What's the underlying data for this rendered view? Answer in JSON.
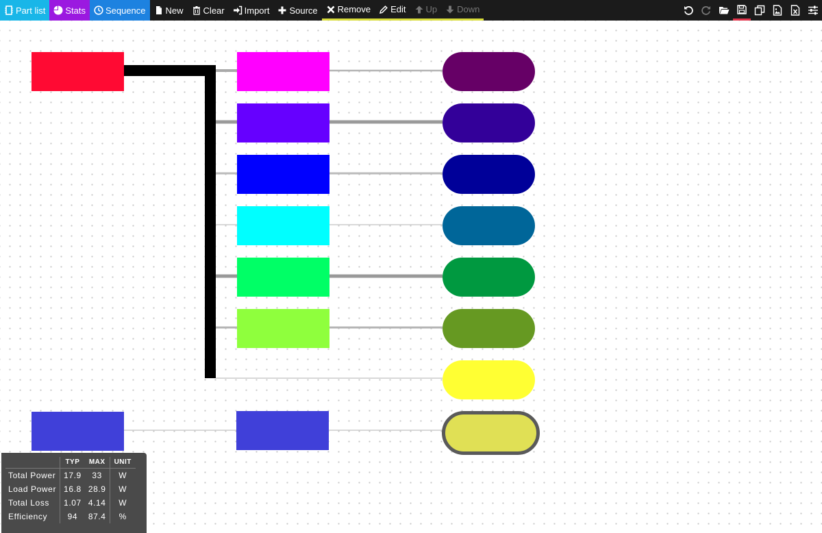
{
  "toolbar": {
    "part_list": "Part list",
    "stats": "Stats",
    "sequence": "Sequence",
    "new": "New",
    "clear": "Clear",
    "import": "Import",
    "source": "Source",
    "remove": "Remove",
    "edit": "Edit",
    "up": "Up",
    "down": "Down",
    "colors": {
      "part_list": "#19b6e8",
      "stats": "#9b19e0",
      "sequence": "#1d82e0",
      "edit_group_underline": "#d8dc3a",
      "save_underline": "#e0334a"
    },
    "right_icons": [
      "undo-icon",
      "redo-icon",
      "open-folder-icon",
      "save-icon",
      "copy-icon",
      "image-icon",
      "spreadsheet-icon",
      "settings-sliders-icon"
    ]
  },
  "diagram": {
    "nodes": {
      "sources": [
        "#ff0a33",
        "#4040d9"
      ],
      "converters": [
        "#ff00ff",
        "#6600ff",
        "#0000ff",
        "#00ffff",
        "#00ff66",
        "#8fff3d",
        "#4040d9"
      ],
      "loads": [
        "#660066",
        "#330099",
        "#000099",
        "#006699",
        "#009940",
        "#669922",
        "#ffff33",
        "#e0e055"
      ],
      "selected_load_border": "#5a5a5a"
    }
  },
  "stats_panel": {
    "headers": [
      "",
      "TYP",
      "MAX",
      "UNIT"
    ],
    "rows": [
      {
        "label": "Total Power",
        "typ": "17.9",
        "max": "33",
        "unit": "W"
      },
      {
        "label": "Load Power",
        "typ": "16.8",
        "max": "28.9",
        "unit": "W"
      },
      {
        "label": "Total Loss",
        "typ": "1.07",
        "max": "4.14",
        "unit": "W"
      },
      {
        "label": "Efficiency",
        "typ": "94",
        "max": "87.4",
        "unit": "%"
      }
    ]
  }
}
